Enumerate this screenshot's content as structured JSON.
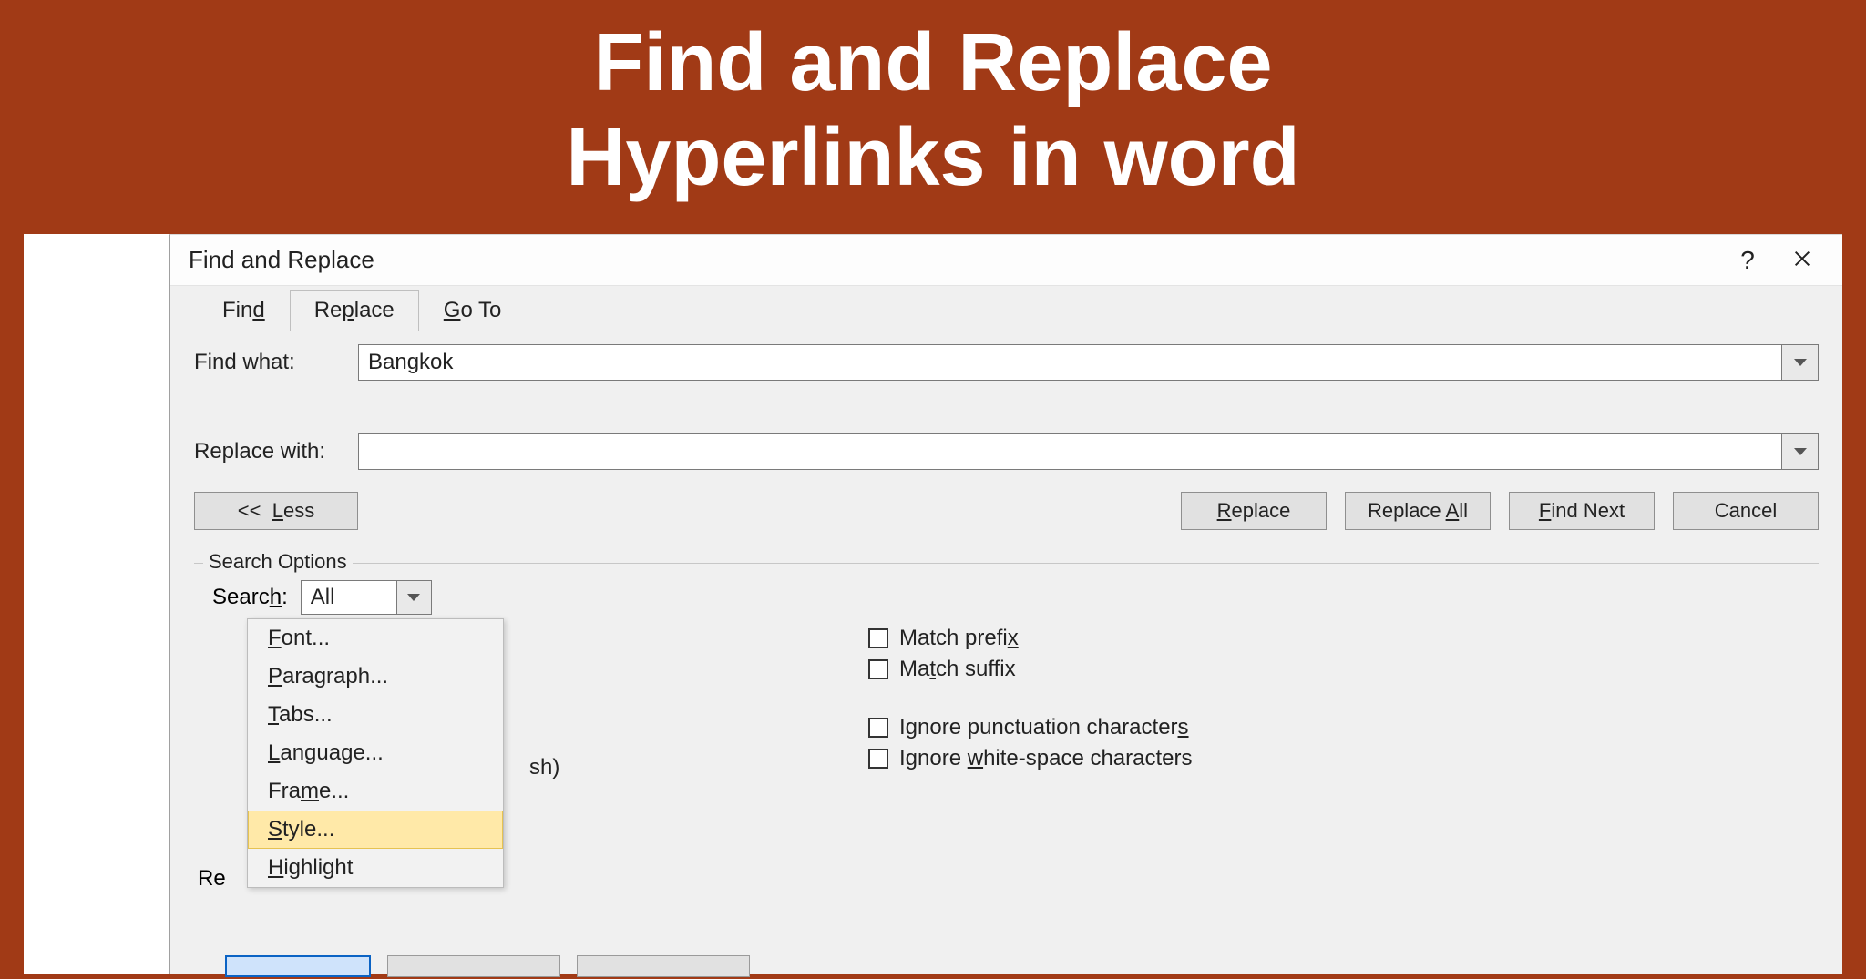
{
  "page_heading": {
    "line1": "Find and Replace",
    "line2": "Hyperlinks in word"
  },
  "dialog": {
    "title": "Find and Replace",
    "help_symbol": "?",
    "tabs": {
      "find": "Find",
      "replace": "Replace",
      "goto": "Go To"
    },
    "find_what_label": "Find what:",
    "find_what_value": "Bangkok",
    "replace_with_label": "Replace with:",
    "replace_with_value": "",
    "buttons": {
      "less": "<<  Less",
      "replace": "Replace",
      "replace_all": "Replace All",
      "find_next": "Find Next",
      "cancel": "Cancel"
    },
    "search_options_label": "Search Options",
    "search_label": "Search:",
    "search_value": "All",
    "format_menu": {
      "font": "Font...",
      "paragraph": "Paragraph...",
      "tabs": "Tabs...",
      "language": "Language...",
      "frame": "Frame...",
      "style": "Style...",
      "highlight": "Highlight"
    },
    "partial_sh": "sh)",
    "re_label": "Re",
    "checkboxes": {
      "match_prefix": "Match prefix",
      "match_suffix": "Match suffix",
      "ignore_punct": "Ignore punctuation characters",
      "ignore_white": "Ignore white-space characters"
    }
  }
}
